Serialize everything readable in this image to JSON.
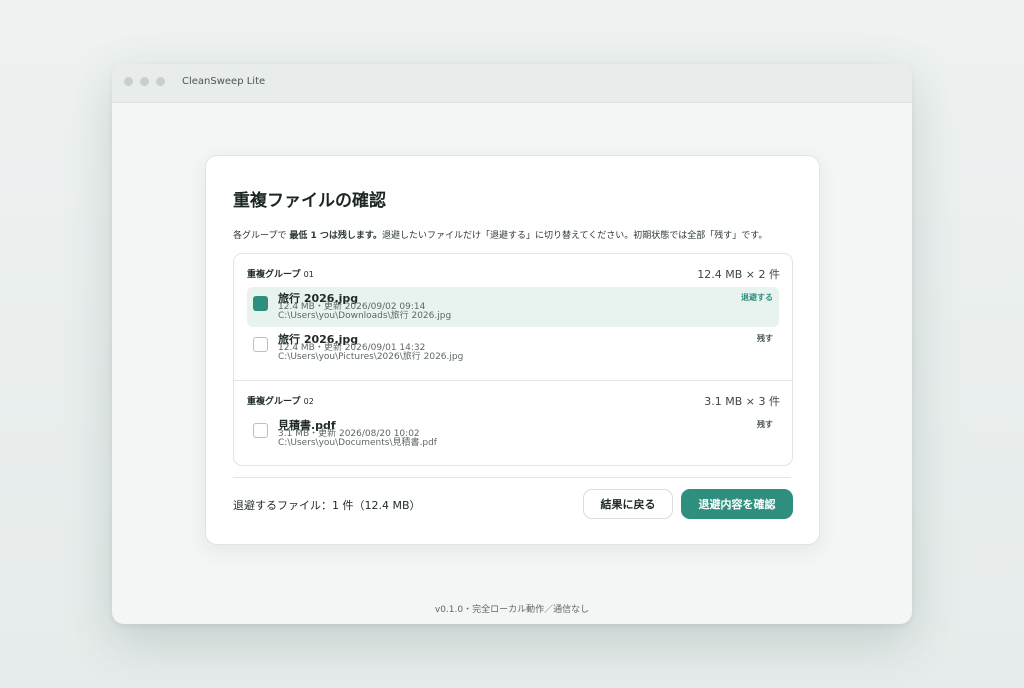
{
  "window": {
    "title": "CleanSweep Lite"
  },
  "dialog": {
    "title": "重複ファイルの確認",
    "instructions": {
      "prefix": "各グループで",
      "emphasis": "最低 1 つは残します。",
      "suffix": "退避したいファイルだけ「退避する」に切り替えてください。初期状態では全部「残す」です。"
    },
    "groups": [
      {
        "label": "重複グループ",
        "number": "01",
        "summary": "12.4 MB × 2 件",
        "files": [
          {
            "name": "旅行 2026.jpg",
            "meta": "12.4 MB・更新 2026/09/02 09:14",
            "path": "C:\\Users\\you\\Downloads\\旅行 2026.jpg",
            "state": "退避する",
            "checked": true
          },
          {
            "name": "旅行 2026.jpg",
            "meta": "12.4 MB・更新 2026/09/01 14:32",
            "path": "C:\\Users\\you\\Pictures\\2026\\旅行 2026.jpg",
            "state": "残す",
            "checked": false
          }
        ]
      },
      {
        "label": "重複グループ",
        "number": "02",
        "summary": "3.1 MB × 3 件",
        "files": [
          {
            "name": "見積書.pdf",
            "meta": "3.1 MB・更新 2026/08/20 10:02",
            "path": "C:\\Users\\you\\Documents\\見積書.pdf",
            "state": "残す",
            "checked": false
          }
        ]
      }
    ],
    "summary": "退避するファイル：1 件（12.4 MB）",
    "back_button": "結果に戻る",
    "confirm_button": "退避内容を確認"
  },
  "footer": {
    "text": "v0.1.0・完全ローカル動作／通信なし"
  },
  "colors": {
    "accent": "#2f8f7f",
    "selected_row": "#e8f2ef"
  }
}
